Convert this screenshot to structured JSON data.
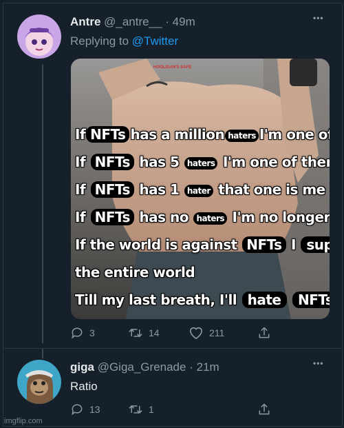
{
  "tweet1": {
    "name": "Antre",
    "handle": "@_antre__",
    "separator": "·",
    "time": "49m",
    "reply_prefix": "Replying to",
    "reply_to": "@Twitter",
    "more": "•••",
    "meme": {
      "tiny_logo": "HOOLIGAN'S SAFE",
      "lines": [
        {
          "pre": "If",
          "w1": "NFTs",
          "mid": "has a million",
          "w2": "haters",
          "post": "I'm one of them"
        },
        {
          "pre": "If",
          "w1": "NFTs",
          "mid": "has 5",
          "w2": "haters",
          "post": "I'm one of them"
        },
        {
          "pre": "If",
          "w1": "NFTs",
          "mid": "has 1",
          "w2": "hater",
          "post": "that one is me"
        },
        {
          "pre": "If",
          "w1": "NFTs",
          "mid": "has no",
          "w2": "haters",
          "post": "I'm no longer alive"
        }
      ],
      "line5_pre": "If the world is against",
      "line5_w1": "NFTs",
      "line5_mid": "I",
      "line5_w2": "support",
      "line6": "the entire world",
      "line7_pre": "Till my last breath, I'll",
      "line7_w1": "hate",
      "line7_w2": "NFTs"
    },
    "actions": {
      "replies": "3",
      "retweets": "14",
      "likes": "211"
    }
  },
  "tweet2": {
    "name": "giga",
    "handle": "@Giga_Grenade",
    "separator": "·",
    "time": "21m",
    "text": "Ratio",
    "more": "•••",
    "actions": {
      "replies": "13",
      "retweets": "1"
    }
  },
  "watermark": "imgflip.com",
  "colors": {
    "background": "#15202b",
    "accent": "#1d9bf0",
    "muted": "#8b98a5"
  }
}
